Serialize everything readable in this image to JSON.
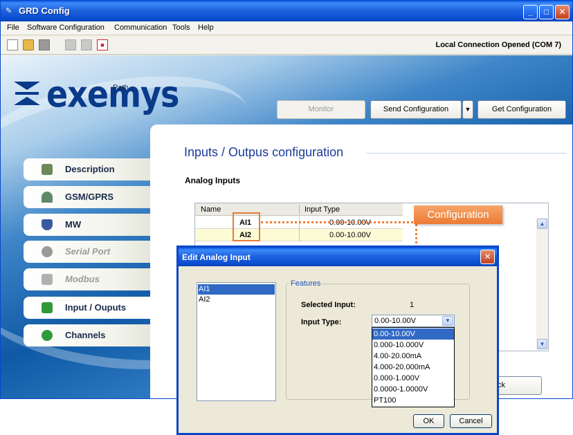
{
  "window": {
    "title": "GRD Config"
  },
  "menu": [
    "File",
    "Software Configuration",
    "Communication",
    "Tools",
    "Help"
  ],
  "toolbar": {
    "status": "Local Connection Opened (COM 7)"
  },
  "brand": {
    "logo": "exemys",
    "path_label": "Path"
  },
  "actions": {
    "monitor": "Monitor",
    "send": "Send Configuration",
    "get": "Get Configuration",
    "hidden_back_fragment": "ck"
  },
  "nav": [
    {
      "label": "Description",
      "icon": "document-check-icon",
      "enabled": true
    },
    {
      "label": "GSM/GPRS",
      "icon": "signal-icon",
      "enabled": true
    },
    {
      "label": "MW",
      "icon": "shield-icon",
      "enabled": true
    },
    {
      "label": "Serial Port",
      "icon": "serial-port-icon",
      "enabled": false
    },
    {
      "label": "Modbus",
      "icon": "modbus-icon",
      "enabled": false
    },
    {
      "label": "Input / Ouputs",
      "icon": "arrows-exchange-icon",
      "enabled": true,
      "active": true
    },
    {
      "label": "Channels",
      "icon": "channels-icon",
      "enabled": true
    }
  ],
  "content": {
    "title": "Inputs / Outpus configuration",
    "section": "Analog Inputs",
    "table": {
      "headers": [
        "Name",
        "Input Type"
      ],
      "rows": [
        {
          "name": "AI1",
          "type": "0.00-10.00V"
        },
        {
          "name": "AI2",
          "type": "0.00-10.00V"
        }
      ]
    }
  },
  "callout": {
    "label": "Configuration",
    "color": "#ec7a34"
  },
  "dialog": {
    "title": "Edit Analog Input",
    "list": [
      "AI1",
      "AI2"
    ],
    "selected_list_index": 0,
    "features_legend": "Features",
    "selected_input_label": "Selected Input:",
    "selected_input_value": "1",
    "input_type_label": "Input Type:",
    "input_type_value": "0.00-10.00V",
    "options": [
      "0.00-10.00V",
      "0.000-10.000V",
      "4.00-20.00mA",
      "4.000-20.000mA",
      "0.000-1.000V",
      "0.0000-1.0000V",
      "PT100"
    ],
    "selected_option_index": 0,
    "ok": "OK",
    "cancel": "Cancel"
  }
}
